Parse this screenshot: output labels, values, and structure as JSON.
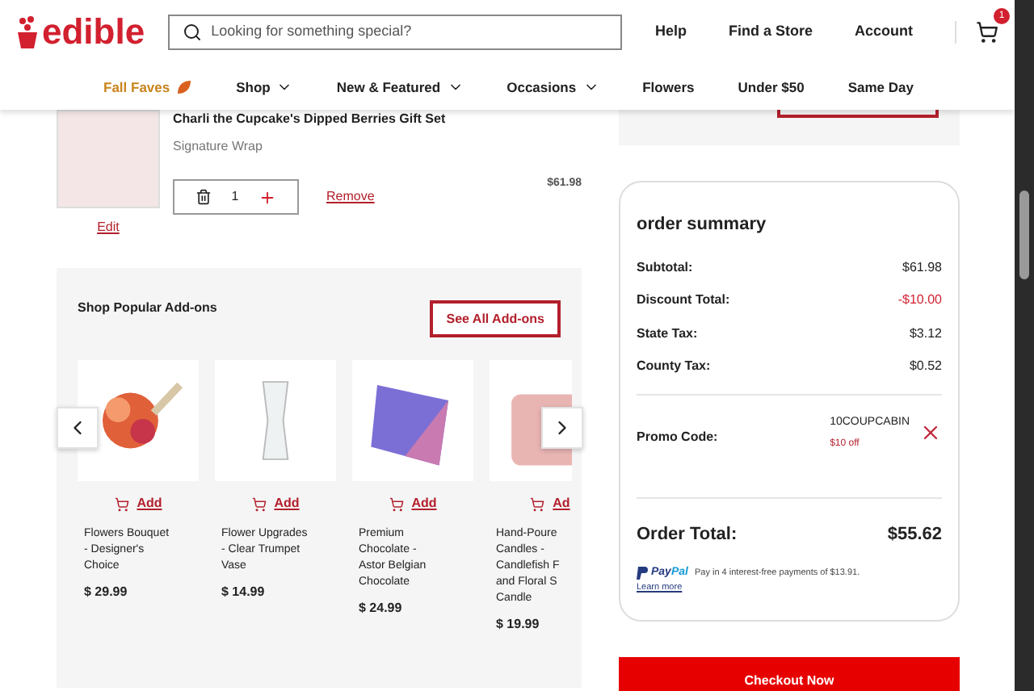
{
  "header": {
    "logo": "edible",
    "search": {
      "placeholder": "Looking for something special?"
    },
    "links": [
      "Help",
      "Find a Store",
      "Account"
    ],
    "cart_count": "1"
  },
  "nav": [
    {
      "label": "Fall Faves",
      "kind": "featured"
    },
    {
      "label": "Shop",
      "kind": "dropdown"
    },
    {
      "label": "New & Featured",
      "kind": "dropdown"
    },
    {
      "label": "Occasions",
      "kind": "dropdown"
    },
    {
      "label": "Flowers",
      "kind": "plain"
    },
    {
      "label": "Under $50",
      "kind": "plain"
    },
    {
      "label": "Same Day",
      "kind": "plain"
    }
  ],
  "cart_item": {
    "name": "Charli the Cupcake's Dipped Berries Gift Set",
    "option": "Signature Wrap",
    "quantity": "1",
    "remove": "Remove",
    "edit": "Edit",
    "price": "$61.98"
  },
  "addons": {
    "title": "Shop Popular Add-ons",
    "see_all": "See All Add-ons",
    "products": [
      {
        "add": "Add",
        "name_lines": [
          "Flowers Bouquet",
          "- Designer's",
          "Choice"
        ],
        "price": "$ 29.99"
      },
      {
        "add": "Add",
        "name_lines": [
          "Flower Upgrades",
          "- Clear Trumpet",
          "Vase"
        ],
        "price": "$ 14.99"
      },
      {
        "add": "Add",
        "name_lines": [
          "Premium",
          "Chocolate -",
          "Astor Belgian",
          "Chocolate"
        ],
        "price": "$ 24.99"
      },
      {
        "add": "Ad",
        "name_lines": [
          "Hand-Poure",
          "Candles -",
          "Candlefish F",
          "and Floral S",
          "Candle"
        ],
        "price": "$ 19.99"
      }
    ]
  },
  "summary": {
    "title": "order summary",
    "rows": [
      {
        "label": "Subtotal:",
        "value": "$61.98",
        "kind": "normal"
      },
      {
        "label": "Discount Total:",
        "value": "-$10.00",
        "kind": "discount"
      },
      {
        "label": "State Tax:",
        "value": "$3.12",
        "kind": "normal"
      },
      {
        "label": "County Tax:",
        "value": "$0.52",
        "kind": "normal"
      }
    ],
    "promo": {
      "label": "Promo Code:",
      "code": "10COUPCABIN",
      "note": "$10 off"
    },
    "total_label": "Order Total:",
    "total": "$55.62",
    "paypal": {
      "brand_a": "Pay",
      "brand_b": "Pal",
      "text": "Pay in 4 interest-free payments of $13.91.",
      "link": "Learn more"
    }
  },
  "checkout": "Checkout Now"
}
